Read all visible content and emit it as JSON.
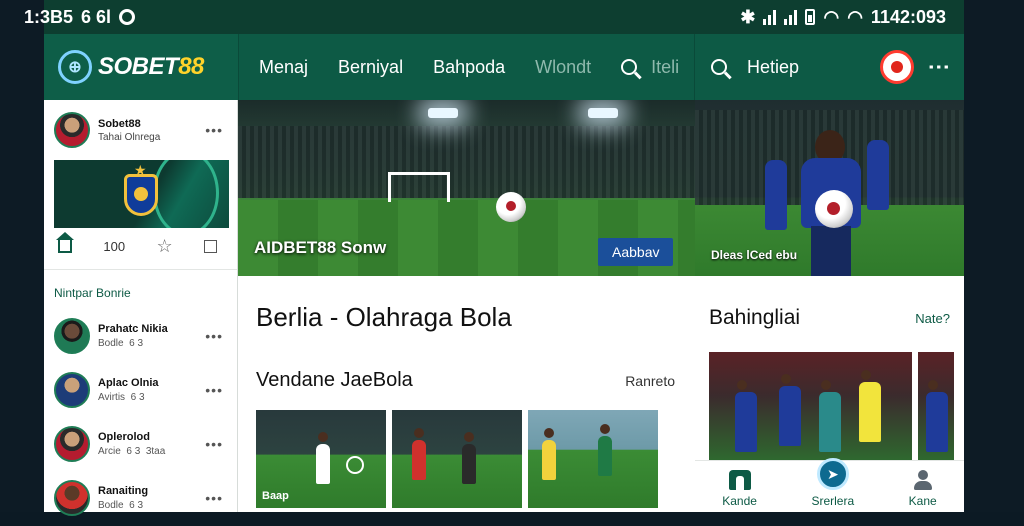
{
  "status_bar": {
    "time_left": "1:3B5",
    "signal_left": "6 6l",
    "time_right": "1142:093"
  },
  "app": {
    "logo_text_white": "SOBET",
    "logo_text_yellow": "88"
  },
  "nav": {
    "items": [
      "Menaj",
      "Berniyal",
      "Bahpoda",
      "Wlondt"
    ],
    "search_label": "Iteli",
    "right_label": "Hetiep"
  },
  "left": {
    "card": {
      "name": "Sobet88",
      "subtitle": "Tahai Olnrega"
    },
    "actions": {
      "count": "100"
    },
    "section_title": "Nintpar Bonrie",
    "list": [
      {
        "name": "Prahatc Nikia",
        "sub1": "Bodle",
        "sub2": "6 3"
      },
      {
        "name": "Aplac Olnia",
        "sub1": "Avirtis",
        "sub2": "6 3"
      },
      {
        "name": "Oplerolod",
        "sub1": "Arcie",
        "sub2": "6 3",
        "sub3": "3taa"
      },
      {
        "name": "Ranaiting",
        "sub1": "Bodle",
        "sub2": "6 3"
      }
    ]
  },
  "middle": {
    "hero_caption": "AIDBET88 Sonw",
    "hero_button": "Aabbav",
    "title": "Berlia - Olahraga Bola",
    "subtitle": "Vendane JaeBola",
    "subtitle_link": "Ranreto",
    "thumb_caption": "Baap"
  },
  "right": {
    "hero_caption": "Dleas lCed ebu",
    "title": "Bahingliai",
    "more": "Nate?",
    "bottom_nav": [
      "Kande",
      "Srerlera",
      "Kane"
    ]
  }
}
